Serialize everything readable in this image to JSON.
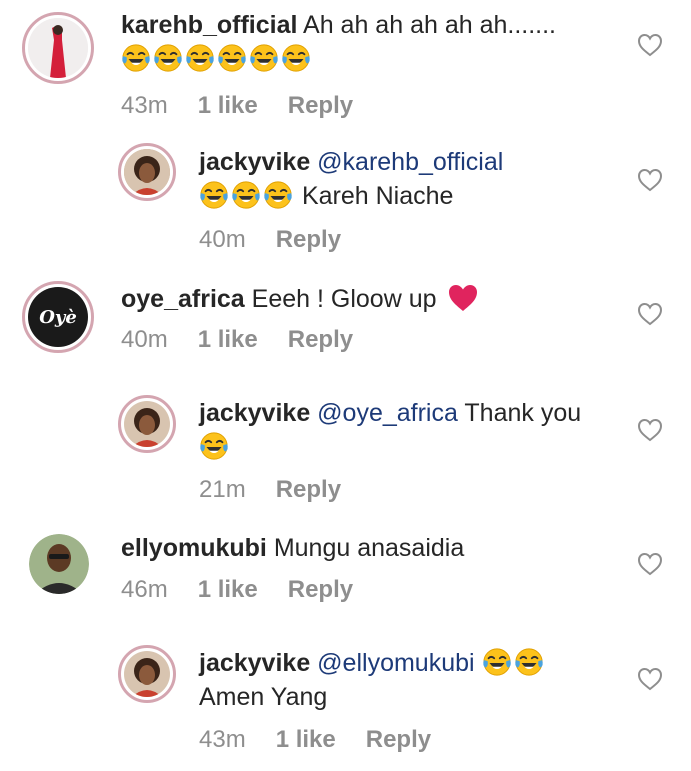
{
  "comments": [
    {
      "username": "karehb_official",
      "text": "Ah ah ah ah ah ah.......",
      "time": "43m",
      "likes": "1 like",
      "reply": "Reply",
      "emoji_count": 6
    },
    {
      "username": "jackyvike",
      "mention": "@karehb_official",
      "text": "Kareh Niache",
      "time": "40m",
      "reply": "Reply",
      "emoji_count": 3
    },
    {
      "username": "oye_africa",
      "text": "Eeeh ! Gloow up",
      "time": "40m",
      "likes": "1 like",
      "reply": "Reply",
      "avatar_text": "Oyè"
    },
    {
      "username": "jackyvike",
      "mention": "@oye_africa",
      "text": "Thank you",
      "time": "21m",
      "reply": "Reply",
      "emoji_count": 1
    },
    {
      "username": "ellyomukubi",
      "text": "Mungu anasaidia",
      "time": "46m",
      "likes": "1 like",
      "reply": "Reply"
    },
    {
      "username": "jackyvike",
      "mention": "@ellyomukubi",
      "text": "Amen Yang",
      "time": "43m",
      "likes": "1 like",
      "reply": "Reply",
      "emoji_count": 2
    }
  ],
  "colors": {
    "text": "#262626",
    "meta": "#8e8e8e",
    "mention": "#1d3a78",
    "heart_outline": "#8e8e8e",
    "red_heart": "#e0245e"
  },
  "icons": {
    "like": "heart-outline-icon",
    "laugh": "face-with-tears-of-joy-icon",
    "love": "red-heart-icon"
  }
}
